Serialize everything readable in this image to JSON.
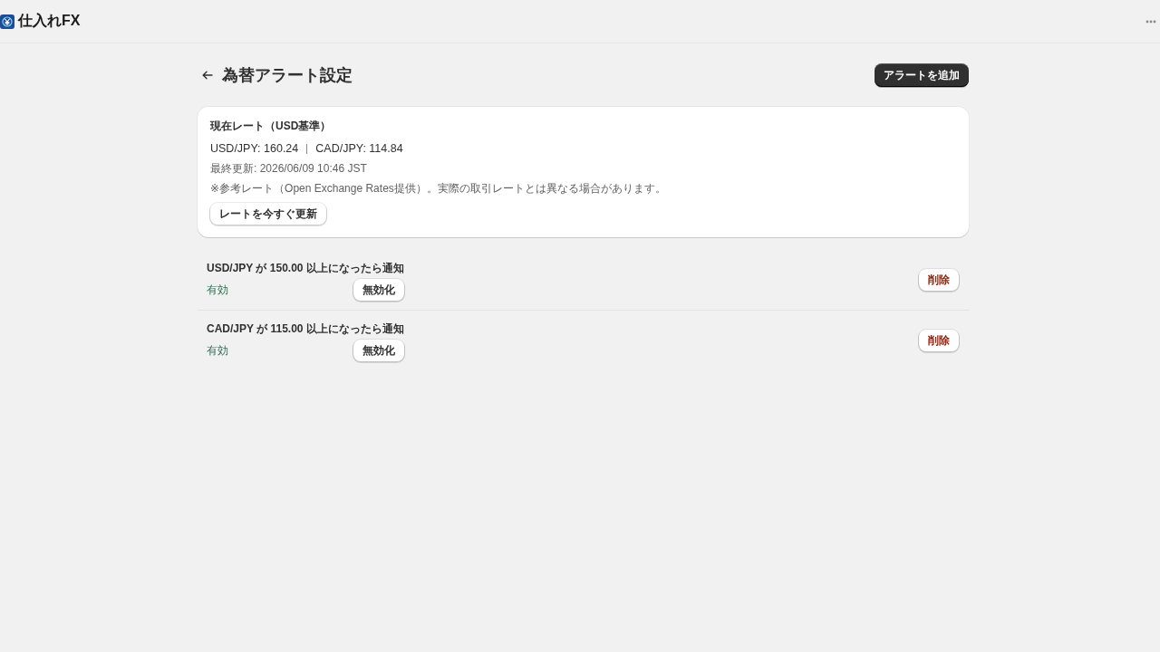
{
  "app_bar": {
    "title": "仕入れFX"
  },
  "page": {
    "title": "為替アラート設定",
    "primary_action": "アラートを追加"
  },
  "rate_card": {
    "title": "現在レート（USD基準）",
    "rates": [
      "USD/JPY: 160.24",
      "CAD/JPY: 114.84"
    ],
    "updated": "最終更新: 2026/06/09 10:46 JST",
    "note": "※参考レート（Open Exchange Rates提供）。実際の取引レートとは異なる場合があります。",
    "refresh_button": "レートを今すぐ更新"
  },
  "alerts": [
    {
      "condition": "USD/JPY が 150.00 以上になったら通知",
      "status": "有効",
      "enabled": true,
      "toggle_button": "無効化",
      "delete_button": "削除"
    },
    {
      "condition": "CAD/JPY が 115.00 以上になったら通知",
      "status": "有効",
      "enabled": true,
      "toggle_button": "無効化",
      "delete_button": "削除"
    }
  ]
}
